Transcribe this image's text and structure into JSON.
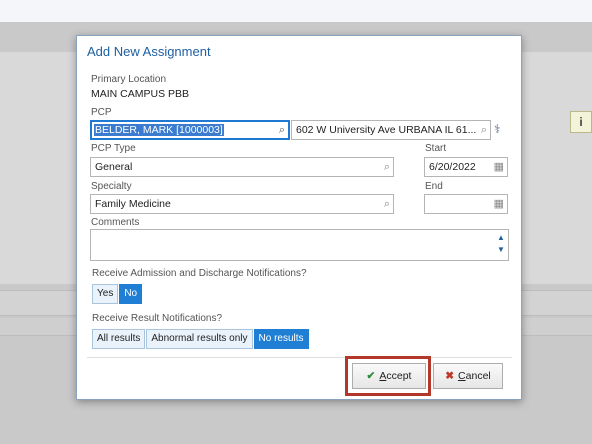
{
  "dialog": {
    "title": "Add New Assignment",
    "primary_location_label": "Primary Location",
    "primary_location_value": "MAIN CAMPUS PBB",
    "pcp_label": "PCP",
    "pcp_value": "BELDER, MARK [1000003]",
    "pcp_address": "602 W University Ave URBANA IL 61...",
    "pcp_type_label": "PCP Type",
    "pcp_type_value": "General",
    "start_label": "Start",
    "start_value": "6/20/2022",
    "specialty_label": "Specialty",
    "specialty_value": "Family Medicine",
    "end_label": "End",
    "end_value": "",
    "comments_label": "Comments",
    "comments_value": "",
    "adm_notif_label": "Receive Admission and Discharge Notifications?",
    "adm_notif_options": [
      "Yes",
      "No"
    ],
    "adm_notif_selected": "No",
    "result_notif_label": "Receive Result Notifications?",
    "result_notif_options": [
      "All results",
      "Abnormal results only",
      "No results"
    ],
    "result_notif_selected": "No results",
    "accept_label_pre": "",
    "accept_label_ul": "A",
    "accept_label_post": "ccept",
    "cancel_label_pre": "",
    "cancel_label_ul": "C",
    "cancel_label_post": "ancel"
  },
  "background": {
    "info_glyph": "i"
  },
  "icons": {
    "search": "search-icon",
    "calendar": "calendar-icon",
    "spinner_up": "chevron-up-icon",
    "spinner_down": "chevron-down-icon",
    "accept": "checkmark-icon",
    "cancel": "x-icon",
    "external_lookup": "provider-lookup-icon"
  },
  "colors": {
    "accent": "#1f7fd4",
    "title": "#1d5fa3",
    "highlight_box": "#b3372a"
  }
}
